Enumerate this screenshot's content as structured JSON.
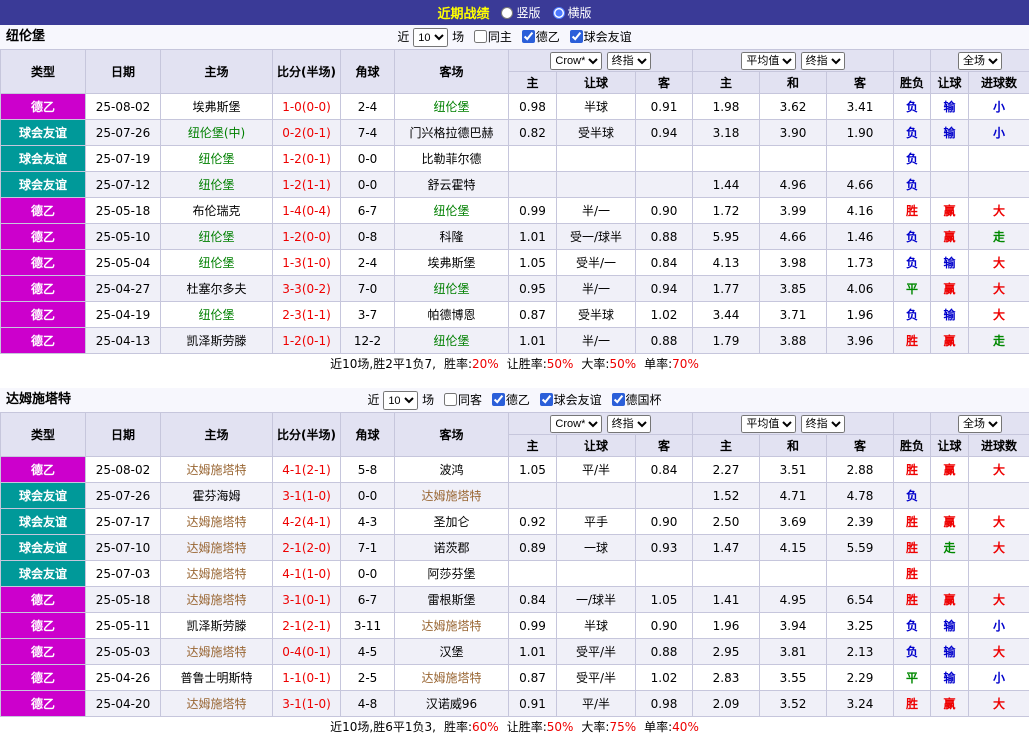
{
  "topbar": {
    "title": "近期战绩",
    "options": [
      {
        "label": "竖版",
        "selected": false
      },
      {
        "label": "横版",
        "selected": true
      }
    ]
  },
  "labels": {
    "near": "近",
    "games": "场",
    "type": "类型",
    "date": "日期",
    "home": "主场",
    "score": "比分(半场)",
    "corner": "角球",
    "away": "客场",
    "home_short": "主",
    "away_short": "客",
    "draw_short": "和",
    "handicap": "让球",
    "result": "胜负",
    "goals": "进球数",
    "bookmaker": "Crow*",
    "final_odds": "终指",
    "average": "平均值",
    "full_match": "全场"
  },
  "type_colors": {
    "德乙": "#cc00cc",
    "球会友谊": "#009999"
  },
  "result_colors": {
    "胜": "#ee0000",
    "负": "#0000cc",
    "平": "#008800",
    "赢": "#ee0000",
    "输": "#0000cc",
    "走": "#008800",
    "大": "#ee0000",
    "小": "#0000cc"
  },
  "sections": [
    {
      "team": "纽伦堡",
      "team_color": "#008000",
      "count": "10",
      "filters": [
        {
          "label": "同主",
          "checked": false
        },
        {
          "label": "德乙",
          "checked": true
        },
        {
          "label": "球会友谊",
          "checked": true
        }
      ],
      "rows": [
        {
          "type": "德乙",
          "date": "25-08-02",
          "home": "埃弗斯堡",
          "hl": "away",
          "score": "1-0(0-0)",
          "corner": "2-4",
          "away": "纽伦堡",
          "o1": "0.98",
          "oh": "半球",
          "o2": "0.91",
          "a1": "1.98",
          "a2": "3.62",
          "a3": "3.41",
          "res": "负",
          "hres": "输",
          "gres": "小"
        },
        {
          "type": "球会友谊",
          "date": "25-07-26",
          "home": "纽伦堡(中)",
          "hl": "home",
          "score": "0-2(0-1)",
          "corner": "7-4",
          "away": "门兴格拉德巴赫",
          "o1": "0.82",
          "oh": "受半球",
          "o2": "0.94",
          "a1": "3.18",
          "a2": "3.90",
          "a3": "1.90",
          "res": "负",
          "hres": "输",
          "gres": "小"
        },
        {
          "type": "球会友谊",
          "date": "25-07-19",
          "home": "纽伦堡",
          "hl": "home",
          "score": "1-2(0-1)",
          "corner": "0-0",
          "away": "比勒菲尔德",
          "o1": "",
          "oh": "",
          "o2": "",
          "a1": "",
          "a2": "",
          "a3": "",
          "res": "负",
          "hres": "",
          "gres": ""
        },
        {
          "type": "球会友谊",
          "date": "25-07-12",
          "home": "纽伦堡",
          "hl": "home",
          "score": "1-2(1-1)",
          "corner": "0-0",
          "away": "舒云霍特",
          "o1": "",
          "oh": "",
          "o2": "",
          "a1": "1.44",
          "a2": "4.96",
          "a3": "4.66",
          "res": "负",
          "hres": "",
          "gres": ""
        },
        {
          "type": "德乙",
          "date": "25-05-18",
          "home": "布伦瑞克",
          "hl": "away",
          "score": "1-4(0-4)",
          "corner": "6-7",
          "away": "纽伦堡",
          "o1": "0.99",
          "oh": "半/一",
          "o2": "0.90",
          "a1": "1.72",
          "a2": "3.99",
          "a3": "4.16",
          "res": "胜",
          "hres": "赢",
          "gres": "大"
        },
        {
          "type": "德乙",
          "date": "25-05-10",
          "home": "纽伦堡",
          "hl": "home",
          "score": "1-2(0-0)",
          "corner": "0-8",
          "away": "科隆",
          "o1": "1.01",
          "oh": "受一/球半",
          "o2": "0.88",
          "a1": "5.95",
          "a2": "4.66",
          "a3": "1.46",
          "res": "负",
          "hres": "赢",
          "gres": "走"
        },
        {
          "type": "德乙",
          "date": "25-05-04",
          "home": "纽伦堡",
          "hl": "home",
          "score": "1-3(1-0)",
          "corner": "2-4",
          "away": "埃弗斯堡",
          "o1": "1.05",
          "oh": "受半/一",
          "o2": "0.84",
          "a1": "4.13",
          "a2": "3.98",
          "a3": "1.73",
          "res": "负",
          "hres": "输",
          "gres": "大"
        },
        {
          "type": "德乙",
          "date": "25-04-27",
          "home": "杜塞尔多夫",
          "hl": "away",
          "score": "3-3(0-2)",
          "corner": "7-0",
          "away": "纽伦堡",
          "o1": "0.95",
          "oh": "半/一",
          "o2": "0.94",
          "a1": "1.77",
          "a2": "3.85",
          "a3": "4.06",
          "res": "平",
          "hres": "赢",
          "gres": "大"
        },
        {
          "type": "德乙",
          "date": "25-04-19",
          "home": "纽伦堡",
          "hl": "home",
          "score": "2-3(1-1)",
          "corner": "3-7",
          "away": "帕德博恩",
          "o1": "0.87",
          "oh": "受半球",
          "o2": "1.02",
          "a1": "3.44",
          "a2": "3.71",
          "a3": "1.96",
          "res": "负",
          "hres": "输",
          "gres": "大"
        },
        {
          "type": "德乙",
          "date": "25-04-13",
          "home": "凯泽斯劳滕",
          "hl": "away",
          "score": "1-2(0-1)",
          "corner": "12-2",
          "away": "纽伦堡",
          "o1": "1.01",
          "oh": "半/一",
          "o2": "0.88",
          "a1": "1.79",
          "a2": "3.88",
          "a3": "3.96",
          "res": "胜",
          "hres": "赢",
          "gres": "走"
        }
      ],
      "summary": {
        "prefix": "近10场,胜2平1负7,",
        "stats": [
          {
            "label": "胜率:",
            "value": "20%"
          },
          {
            "label": "让胜率:",
            "value": "50%"
          },
          {
            "label": "大率:",
            "value": "50%"
          },
          {
            "label": "单率:",
            "value": "70%"
          }
        ]
      }
    },
    {
      "team": "达姆施塔特",
      "team_color": "#996633",
      "count": "10",
      "filters": [
        {
          "label": "同客",
          "checked": false
        },
        {
          "label": "德乙",
          "checked": true
        },
        {
          "label": "球会友谊",
          "checked": true
        },
        {
          "label": "德国杯",
          "checked": true
        }
      ],
      "rows": [
        {
          "type": "德乙",
          "date": "25-08-02",
          "home": "达姆施塔特",
          "hl": "home",
          "score": "4-1(2-1)",
          "corner": "5-8",
          "away": "波鸿",
          "o1": "1.05",
          "oh": "平/半",
          "o2": "0.84",
          "a1": "2.27",
          "a2": "3.51",
          "a3": "2.88",
          "res": "胜",
          "hres": "赢",
          "gres": "大"
        },
        {
          "type": "球会友谊",
          "date": "25-07-26",
          "home": "霍芬海姆",
          "hl": "away",
          "score": "3-1(1-0)",
          "corner": "0-0",
          "away": "达姆施塔特",
          "o1": "",
          "oh": "",
          "o2": "",
          "a1": "1.52",
          "a2": "4.71",
          "a3": "4.78",
          "res": "负",
          "hres": "",
          "gres": ""
        },
        {
          "type": "球会友谊",
          "date": "25-07-17",
          "home": "达姆施塔特",
          "hl": "home",
          "score": "4-2(4-1)",
          "corner": "4-3",
          "away": "圣加仑",
          "o1": "0.92",
          "oh": "平手",
          "o2": "0.90",
          "a1": "2.50",
          "a2": "3.69",
          "a3": "2.39",
          "res": "胜",
          "hres": "赢",
          "gres": "大"
        },
        {
          "type": "球会友谊",
          "date": "25-07-10",
          "home": "达姆施塔特",
          "hl": "home",
          "score": "2-1(2-0)",
          "corner": "7-1",
          "away": "诺茨郡",
          "o1": "0.89",
          "oh": "一球",
          "o2": "0.93",
          "a1": "1.47",
          "a2": "4.15",
          "a3": "5.59",
          "res": "胜",
          "hres": "走",
          "gres": "大"
        },
        {
          "type": "球会友谊",
          "date": "25-07-03",
          "home": "达姆施塔特",
          "hl": "home",
          "score": "4-1(1-0)",
          "corner": "0-0",
          "away": "阿莎芬堡",
          "o1": "",
          "oh": "",
          "o2": "",
          "a1": "",
          "a2": "",
          "a3": "",
          "res": "胜",
          "hres": "",
          "gres": ""
        },
        {
          "type": "德乙",
          "date": "25-05-18",
          "home": "达姆施塔特",
          "hl": "home",
          "score": "3-1(0-1)",
          "corner": "6-7",
          "away": "雷根斯堡",
          "o1": "0.84",
          "oh": "一/球半",
          "o2": "1.05",
          "a1": "1.41",
          "a2": "4.95",
          "a3": "6.54",
          "res": "胜",
          "hres": "赢",
          "gres": "大"
        },
        {
          "type": "德乙",
          "date": "25-05-11",
          "home": "凯泽斯劳滕",
          "hl": "away",
          "score": "2-1(2-1)",
          "corner": "3-11",
          "away": "达姆施塔特",
          "o1": "0.99",
          "oh": "半球",
          "o2": "0.90",
          "a1": "1.96",
          "a2": "3.94",
          "a3": "3.25",
          "res": "负",
          "hres": "输",
          "gres": "小"
        },
        {
          "type": "德乙",
          "date": "25-05-03",
          "home": "达姆施塔特",
          "hl": "home",
          "score": "0-4(0-1)",
          "corner": "4-5",
          "away": "汉堡",
          "o1": "1.01",
          "oh": "受平/半",
          "o2": "0.88",
          "a1": "2.95",
          "a2": "3.81",
          "a3": "2.13",
          "res": "负",
          "hres": "输",
          "gres": "大"
        },
        {
          "type": "德乙",
          "date": "25-04-26",
          "home": "普鲁士明斯特",
          "hl": "away",
          "score": "1-1(0-1)",
          "corner": "2-5",
          "away": "达姆施塔特",
          "o1": "0.87",
          "oh": "受平/半",
          "o2": "1.02",
          "a1": "2.83",
          "a2": "3.55",
          "a3": "2.29",
          "res": "平",
          "hres": "输",
          "gres": "小"
        },
        {
          "type": "德乙",
          "date": "25-04-20",
          "home": "达姆施塔特",
          "hl": "home",
          "score": "3-1(1-0)",
          "corner": "4-8",
          "away": "汉诺威96",
          "o1": "0.91",
          "oh": "平/半",
          "o2": "0.98",
          "a1": "2.09",
          "a2": "3.52",
          "a3": "3.24",
          "res": "胜",
          "hres": "赢",
          "gres": "大"
        }
      ],
      "summary": {
        "prefix": "近10场,胜6平1负3,",
        "stats": [
          {
            "label": "胜率:",
            "value": "60%"
          },
          {
            "label": "让胜率:",
            "value": "50%"
          },
          {
            "label": "大率:",
            "value": "75%"
          },
          {
            "label": "单率:",
            "value": "40%"
          }
        ]
      }
    }
  ]
}
